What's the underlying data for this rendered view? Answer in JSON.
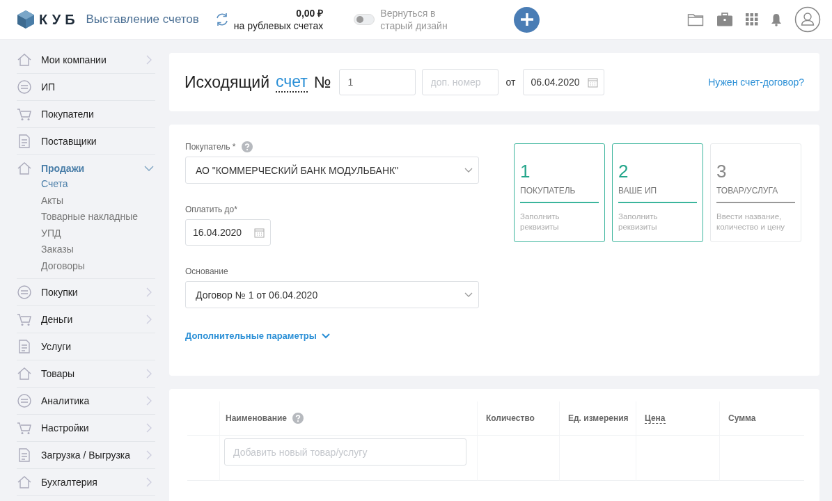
{
  "header": {
    "logo": "КУБ",
    "app_title": "Выставление счетов",
    "balance": {
      "amount": "0,00 ₽",
      "label": "на рублевых счетах"
    },
    "design_toggle": {
      "label": "Вернуться в старый дизайн",
      "on": false
    }
  },
  "sidebar": {
    "items": [
      {
        "label": "Мои компании",
        "kind": "group",
        "expanded": false,
        "selected": false
      },
      {
        "label": "ИП",
        "kind": "link",
        "selected": false
      },
      {
        "label": "Покупатели",
        "kind": "link",
        "selected": false
      },
      {
        "label": "Поставщики",
        "kind": "link",
        "selected": false
      },
      {
        "label": "Продажи",
        "kind": "group",
        "expanded": true,
        "selected": true,
        "children": [
          {
            "label": "Счета",
            "selected": true
          },
          {
            "label": "Акты",
            "selected": false
          },
          {
            "label": "Товарные накладные",
            "selected": false
          },
          {
            "label": "УПД",
            "selected": false
          },
          {
            "label": "Заказы",
            "selected": false
          },
          {
            "label": "Договоры",
            "selected": false
          }
        ]
      },
      {
        "label": "Покупки",
        "kind": "group",
        "expanded": false,
        "selected": false
      },
      {
        "label": "Деньги",
        "kind": "group",
        "expanded": false,
        "selected": false
      },
      {
        "label": "Услуги",
        "kind": "link",
        "selected": false
      },
      {
        "label": "Товары",
        "kind": "group",
        "expanded": false,
        "selected": false
      },
      {
        "label": "Аналитика",
        "kind": "group",
        "expanded": false,
        "selected": false
      },
      {
        "label": "Настройки",
        "kind": "group",
        "expanded": false,
        "selected": false
      },
      {
        "label": "Загрузка / Выгрузка",
        "kind": "group",
        "expanded": false,
        "selected": false
      },
      {
        "label": "Бухгалтерия",
        "kind": "group",
        "expanded": false,
        "selected": false
      }
    ]
  },
  "invoice_header": {
    "title": "Исходящий",
    "type_link": "счет",
    "number_sign": "№",
    "number": "1",
    "extra_number": {
      "placeholder": "доп. номер"
    },
    "date_prefix": "от",
    "date": "06.04.2020",
    "contract_link": "Нужен счет-договор?"
  },
  "form": {
    "buyer": {
      "label": "Покупатель *",
      "value": "АО \"КОММЕРЧЕСКИЙ БАНК МОДУЛЬБАНК\""
    },
    "pay_until": {
      "label": "Оплатить до*",
      "value": "16.04.2020"
    },
    "basis": {
      "label": "Основание",
      "value": "Договор № 1 от 06.04.2020"
    },
    "more_link": "Дополнительные параметры"
  },
  "steps": [
    {
      "number": "1",
      "title": "ПОКУПАТЕЛЬ",
      "hint": "Заполнить реквизиты",
      "done": true
    },
    {
      "number": "2",
      "title": "ВАШЕ ИП",
      "hint": "Заполнить реквизиты",
      "done": true
    },
    {
      "number": "3",
      "title": "ТОВАР/УСЛУГА",
      "hint": "Ввести название, количество и цену",
      "done": false
    }
  ],
  "table": {
    "columns": [
      {
        "label": "Наименование",
        "kind": "help"
      },
      {
        "label": "Количество",
        "kind": "plain"
      },
      {
        "label": "Ед. измерения",
        "kind": "plain"
      },
      {
        "label": "Цена",
        "kind": "dashed"
      },
      {
        "label": "Сумма",
        "kind": "plain"
      }
    ],
    "new_item": {
      "placeholder": "Добавить новый товар/услугу"
    }
  }
}
